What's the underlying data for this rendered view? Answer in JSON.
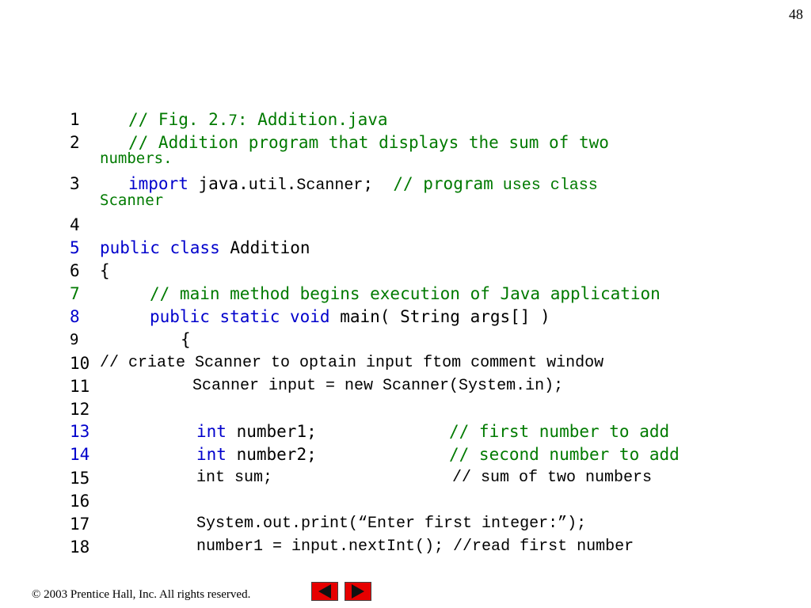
{
  "page_number": "48",
  "footer": {
    "copyright_symbol": "©",
    "text": " 2003 Prentice Hall, Inc.  All rights reserved."
  },
  "nav": {
    "prev_icon": "left-arrow-icon",
    "next_icon": "right-arrow-icon",
    "accent": "#e60000"
  },
  "code": {
    "lines": [
      {
        "num": "1",
        "parts": [
          "// Fig. 2.",
          "7",
          ": Addition.java"
        ]
      },
      {
        "num": "2",
        "parts": [
          "// Addition program that displays the sum of two",
          "numbers."
        ]
      },
      {
        "num": "3",
        "parts": [
          "import",
          " java.",
          "util",
          ".",
          "Scanner",
          ";  ",
          "// program",
          " uses class",
          "Scanner"
        ]
      },
      {
        "num": "4",
        "parts": []
      },
      {
        "num": "5",
        "parts": [
          "public class",
          " Addition"
        ]
      },
      {
        "num": "6",
        "parts": [
          "{"
        ]
      },
      {
        "num": "7",
        "parts": [
          "// main method begins execution of Java application"
        ]
      },
      {
        "num": "8",
        "parts": [
          "public static void",
          " main( String args[] )"
        ]
      },
      {
        "num": "9",
        "parts": [
          "{"
        ]
      },
      {
        "num": "10",
        "parts": [
          "// criate Scanner to optain input ftom comment window"
        ]
      },
      {
        "num": "11",
        "parts": [
          "Scanner input = new Scanner(System.in);"
        ]
      },
      {
        "num": "12",
        "parts": []
      },
      {
        "num": "13",
        "parts": [
          "int",
          " number1;",
          "// first number to add"
        ]
      },
      {
        "num": "14",
        "parts": [
          "int",
          " number2;",
          "// second number to add"
        ]
      },
      {
        "num": "15",
        "parts": [
          "int sum;",
          "// sum of two numbers"
        ]
      },
      {
        "num": "16",
        "parts": []
      },
      {
        "num": "17",
        "parts": [
          "System.out.print(“Enter first integer:”);"
        ]
      },
      {
        "num": "18",
        "parts": [
          "number1 = input.nextInt(); //read first number"
        ]
      }
    ],
    "colors": {
      "keyword": "#0000cc",
      "comment": "#007a00",
      "text": "#000000"
    }
  }
}
